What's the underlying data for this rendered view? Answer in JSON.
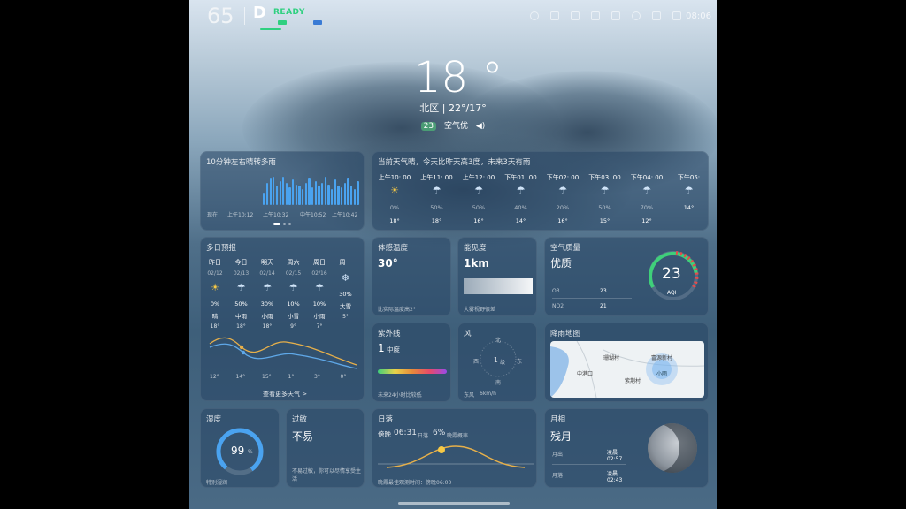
{
  "status": {
    "speed": "65",
    "gear": "D",
    "ready": "READY",
    "clock": "08:06",
    "icons": [
      "user-icon",
      "battery-icon",
      "rotate-icon",
      "bluetooth-icon",
      "device-icon",
      "mic-icon",
      "eye-icon",
      "pause-icon"
    ]
  },
  "weather": {
    "temperature": "18 °",
    "location": "北区",
    "range": "22°/17°",
    "aqi_badge": "23",
    "aqi_label": "空气优",
    "speaker_icon": "speaker-icon"
  },
  "precip": {
    "title": "10分钟左右晴转多雨",
    "now_label": "现在",
    "times": [
      "上午10:12",
      "上午10:32",
      "中午10:52",
      "上午10:42"
    ],
    "bars": [
      0,
      0,
      0,
      0,
      0,
      0,
      0,
      0,
      0,
      0,
      0,
      0,
      0,
      0,
      0,
      0,
      0,
      0.4,
      0.7,
      0.85,
      0.9,
      0.6,
      0.75,
      0.9,
      0.7,
      0.55,
      0.8,
      0.65,
      0.6,
      0.5,
      0.7,
      0.85,
      0.55,
      0.75,
      0.6,
      0.7,
      0.9,
      0.65,
      0.5,
      0.8,
      0.6,
      0.55,
      0.7,
      0.85,
      0.6,
      0.5,
      0.75
    ]
  },
  "hourly": {
    "title": "当前天气晴，今天比昨天高3度，未来3天有雨",
    "hours": [
      {
        "time": "上午10: 00",
        "icon": "sun-cloud-icon",
        "pop": "0%",
        "temp": "18°"
      },
      {
        "time": "上午11: 00",
        "icon": "rain-icon",
        "pop": "50%",
        "temp": "18°"
      },
      {
        "time": "上午12: 00",
        "icon": "rain-icon",
        "pop": "50%",
        "temp": "16°"
      },
      {
        "time": "下午01: 00",
        "icon": "rain-icon",
        "pop": "40%",
        "temp": "14°"
      },
      {
        "time": "下午02: 00",
        "icon": "rain-icon",
        "pop": "20%",
        "temp": "16°"
      },
      {
        "time": "下午03: 00",
        "icon": "rain-icon",
        "pop": "50%",
        "temp": "15°"
      },
      {
        "time": "下午04: 00",
        "icon": "rain-icon",
        "pop": "70%",
        "temp": "12°"
      },
      {
        "time": "下午05:",
        "icon": "rain-icon",
        "pop": "",
        "temp": "14°"
      }
    ]
  },
  "daily": {
    "title": "多日预报",
    "more": "查看更多天气 >",
    "days": [
      {
        "name": "昨日",
        "date": "02/12",
        "icon": "sun-icon",
        "pop": "0%",
        "desc": "晴",
        "high": "18°",
        "low": "12°"
      },
      {
        "name": "今日",
        "date": "02/13",
        "icon": "rain-icon",
        "pop": "50%",
        "desc": "中雨",
        "high": "18°",
        "low": "14°"
      },
      {
        "name": "明天",
        "date": "02/14",
        "icon": "rain-icon",
        "pop": "30%",
        "desc": "小雨",
        "high": "18°",
        "low": "15°"
      },
      {
        "name": "周六",
        "date": "02/15",
        "icon": "rain-icon",
        "pop": "10%",
        "desc": "小雪",
        "high": "9°",
        "low": "1°"
      },
      {
        "name": "周日",
        "date": "02/16",
        "icon": "rain-icon",
        "pop": "10%",
        "desc": "小雨",
        "high": "7°",
        "low": "3°"
      },
      {
        "name": "周一",
        "date": "",
        "icon": "snow-icon",
        "pop": "30%",
        "desc": "大雪",
        "high": "5°",
        "low": "0°"
      }
    ]
  },
  "feels": {
    "title": "体感温度",
    "value": "30°",
    "note": "比实际温度高2°"
  },
  "visibility": {
    "title": "能见度",
    "value": "1km",
    "note": "大雾视野很差"
  },
  "aq": {
    "title": "空气质量",
    "level": "优质",
    "aqi": "23",
    "aqi_label": "AQI",
    "o3_label": "O3",
    "o3": "23",
    "no2_label": "NO2",
    "no2": "21"
  },
  "uv": {
    "title": "紫外线",
    "value": "1",
    "level": "中度",
    "note": "未来24小时比较低"
  },
  "wind": {
    "title": "风",
    "speed": "1",
    "unit": "级",
    "note": "东风",
    "speed2": "6km/h",
    "n": "北",
    "s": "南",
    "e": "东",
    "w": "西"
  },
  "map": {
    "title": "降雨地图",
    "labels": [
      "珊瑚村",
      "中港口",
      "紫荆村",
      "富源新村",
      "小雨"
    ]
  },
  "humidity": {
    "title": "湿度",
    "value": "99",
    "unit": "%",
    "note": "特别湿润"
  },
  "allergy": {
    "title": "过敏",
    "value": "不易",
    "note": "不易过敏，你可以尽情享受生活"
  },
  "sunset": {
    "title": "日落",
    "time_prefix": "傍晚",
    "time": "06:31",
    "time_suffix": "日落",
    "pct": "6%",
    "pct_label": "晚霞概率",
    "note": "晚霞最佳观测时间：傍晚06:00"
  },
  "moon": {
    "title": "月相",
    "phase": "残月",
    "rise_label": "月出",
    "rise_prefix": "凌晨",
    "rise_time": "02:57",
    "set_label": "月落",
    "set_prefix": "凌晨",
    "set_time": "02:43"
  }
}
